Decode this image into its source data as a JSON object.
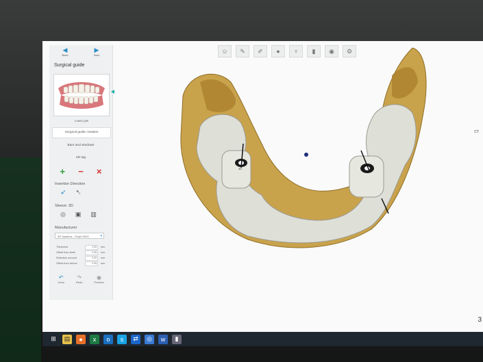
{
  "nav": {
    "back_label": "Back",
    "next_label": "Next"
  },
  "panel": {
    "title": "Surgical guide",
    "thumbnail_caption": "Lower jaw",
    "steps": [
      {
        "label": "Surgical guide creation",
        "active": true
      },
      {
        "label": "Bars and windows",
        "active": false
      },
      {
        "label": "3D tag",
        "active": false
      }
    ],
    "actions": {
      "add": "+",
      "remove": "−",
      "delete": "×"
    },
    "insertion_direction_label": "Insertion Direction",
    "sleeve_label": "Sleeve: 3D",
    "manufacturer_label": "Manufacturer",
    "manufacturer_value": "3D Systems - Projet 3510",
    "params": [
      {
        "label": "Thickness",
        "value": "2.00",
        "unit": "mm"
      },
      {
        "label": "Offset from teeth",
        "value": "0.05",
        "unit": "mm"
      },
      {
        "label": "Retention amount",
        "value": "0.00",
        "unit": "mm"
      },
      {
        "label": "Offset from sleeve",
        "value": "0.05",
        "unit": "mm"
      }
    ],
    "bottom": {
      "undo": "Undo",
      "redo": "Redo",
      "preview": "Preview"
    }
  },
  "viewport": {
    "sleeve_label_left": "3D",
    "page_indicator": "3"
  },
  "right_labels": {
    "ct": "CT"
  },
  "colors": {
    "accent": "#2a8ec7",
    "add": "#2e9b3a",
    "remove": "#d63030",
    "bone": "#c9a24c",
    "guide": "#dedfd6",
    "taskbar": "#1f2730"
  },
  "taskbar_icons": [
    "windows-logo-icon",
    "file-explorer-icon",
    "firefox-icon",
    "excel-icon",
    "outlook-icon",
    "skype-icon",
    "teamviewer-icon",
    "chrome-icon",
    "word-icon",
    "app-icon"
  ]
}
